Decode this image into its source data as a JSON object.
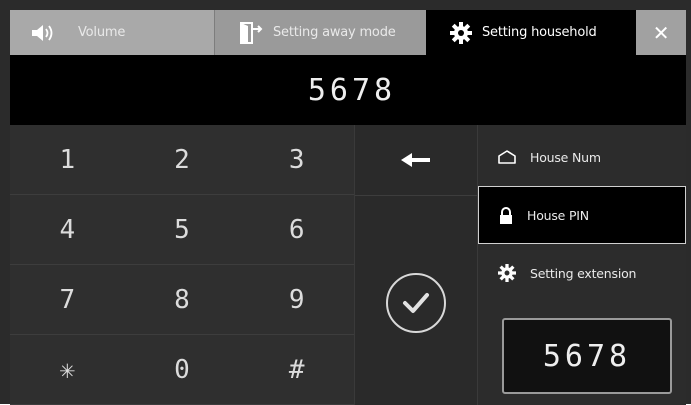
{
  "tabs": {
    "volume": {
      "label": "Volume",
      "icon": "speaker-icon"
    },
    "away_mode": {
      "label": "Setting away mode",
      "icon": "exit-door-icon"
    },
    "household": {
      "label": "Setting household",
      "icon": "gear-icon",
      "active": true
    },
    "close": {
      "label": "✕",
      "icon": "close-icon"
    }
  },
  "display": {
    "value": "5678"
  },
  "keypad": {
    "keys": [
      "1",
      "2",
      "3",
      "4",
      "5",
      "6",
      "7",
      "8",
      "9",
      "✳",
      "0",
      "#"
    ]
  },
  "actions": {
    "backspace_icon": "backspace-arrow-icon",
    "confirm_icon": "check-circle-icon"
  },
  "menu": {
    "house_num": {
      "label": "House Num",
      "icon": "house-icon"
    },
    "house_pin": {
      "label": "House PIN",
      "icon": "lock-icon",
      "selected": true
    },
    "extension": {
      "label": "Setting extension",
      "icon": "gear-icon"
    }
  },
  "pin_display": {
    "value": "5678"
  },
  "colors": {
    "active_tab": "#000000",
    "inactive_tab": "#a9a9a9",
    "panel": "#2b2b2b",
    "text": "#e9e9e9"
  }
}
